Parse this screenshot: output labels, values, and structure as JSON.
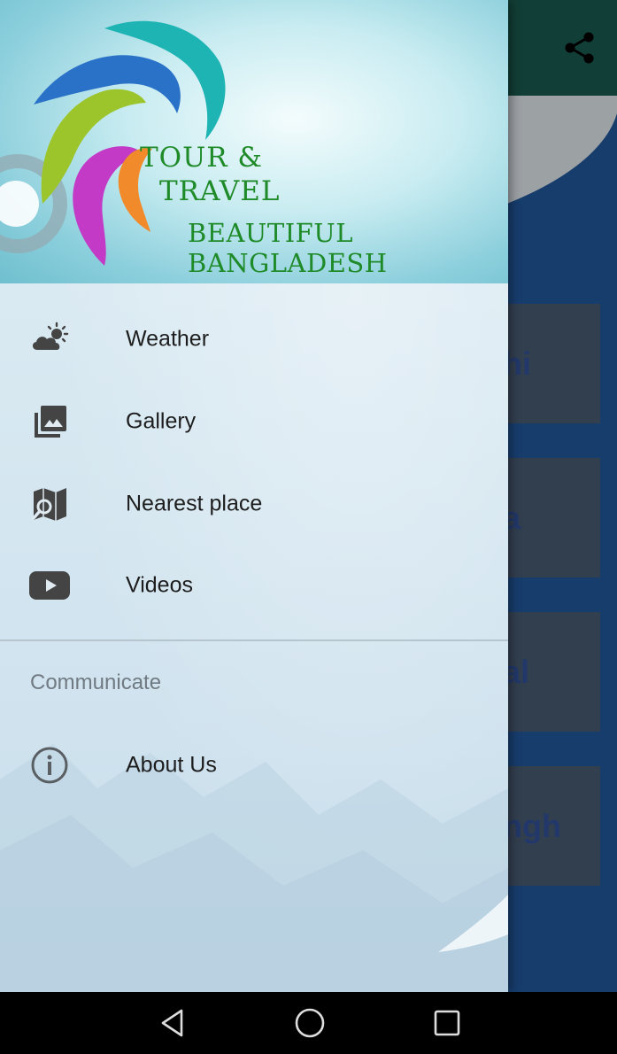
{
  "app": {
    "cards": [
      {
        "partial_label": "hi"
      },
      {
        "partial_label": "a"
      },
      {
        "partial_label": "al"
      },
      {
        "partial_label": "ngh"
      }
    ]
  },
  "drawer": {
    "brand": {
      "line1": "TOUR &",
      "line2": "TRAVEL",
      "line3": "BEAUTIFUL BANGLADESH"
    },
    "items": [
      {
        "label": "Weather",
        "icon": "weather-icon"
      },
      {
        "label": "Gallery",
        "icon": "gallery-icon"
      },
      {
        "label": "Nearest place",
        "icon": "map-search-icon"
      },
      {
        "label": "Videos",
        "icon": "youtube-icon"
      }
    ],
    "section_title": "Communicate",
    "section_items": [
      {
        "label": "About Us",
        "icon": "info-icon"
      }
    ]
  },
  "colors": {
    "toolbar": "#113e36",
    "app_background": "#173d6d",
    "card": "#323f4f",
    "brand_text": "#1e8a28",
    "icon": "#444444"
  }
}
